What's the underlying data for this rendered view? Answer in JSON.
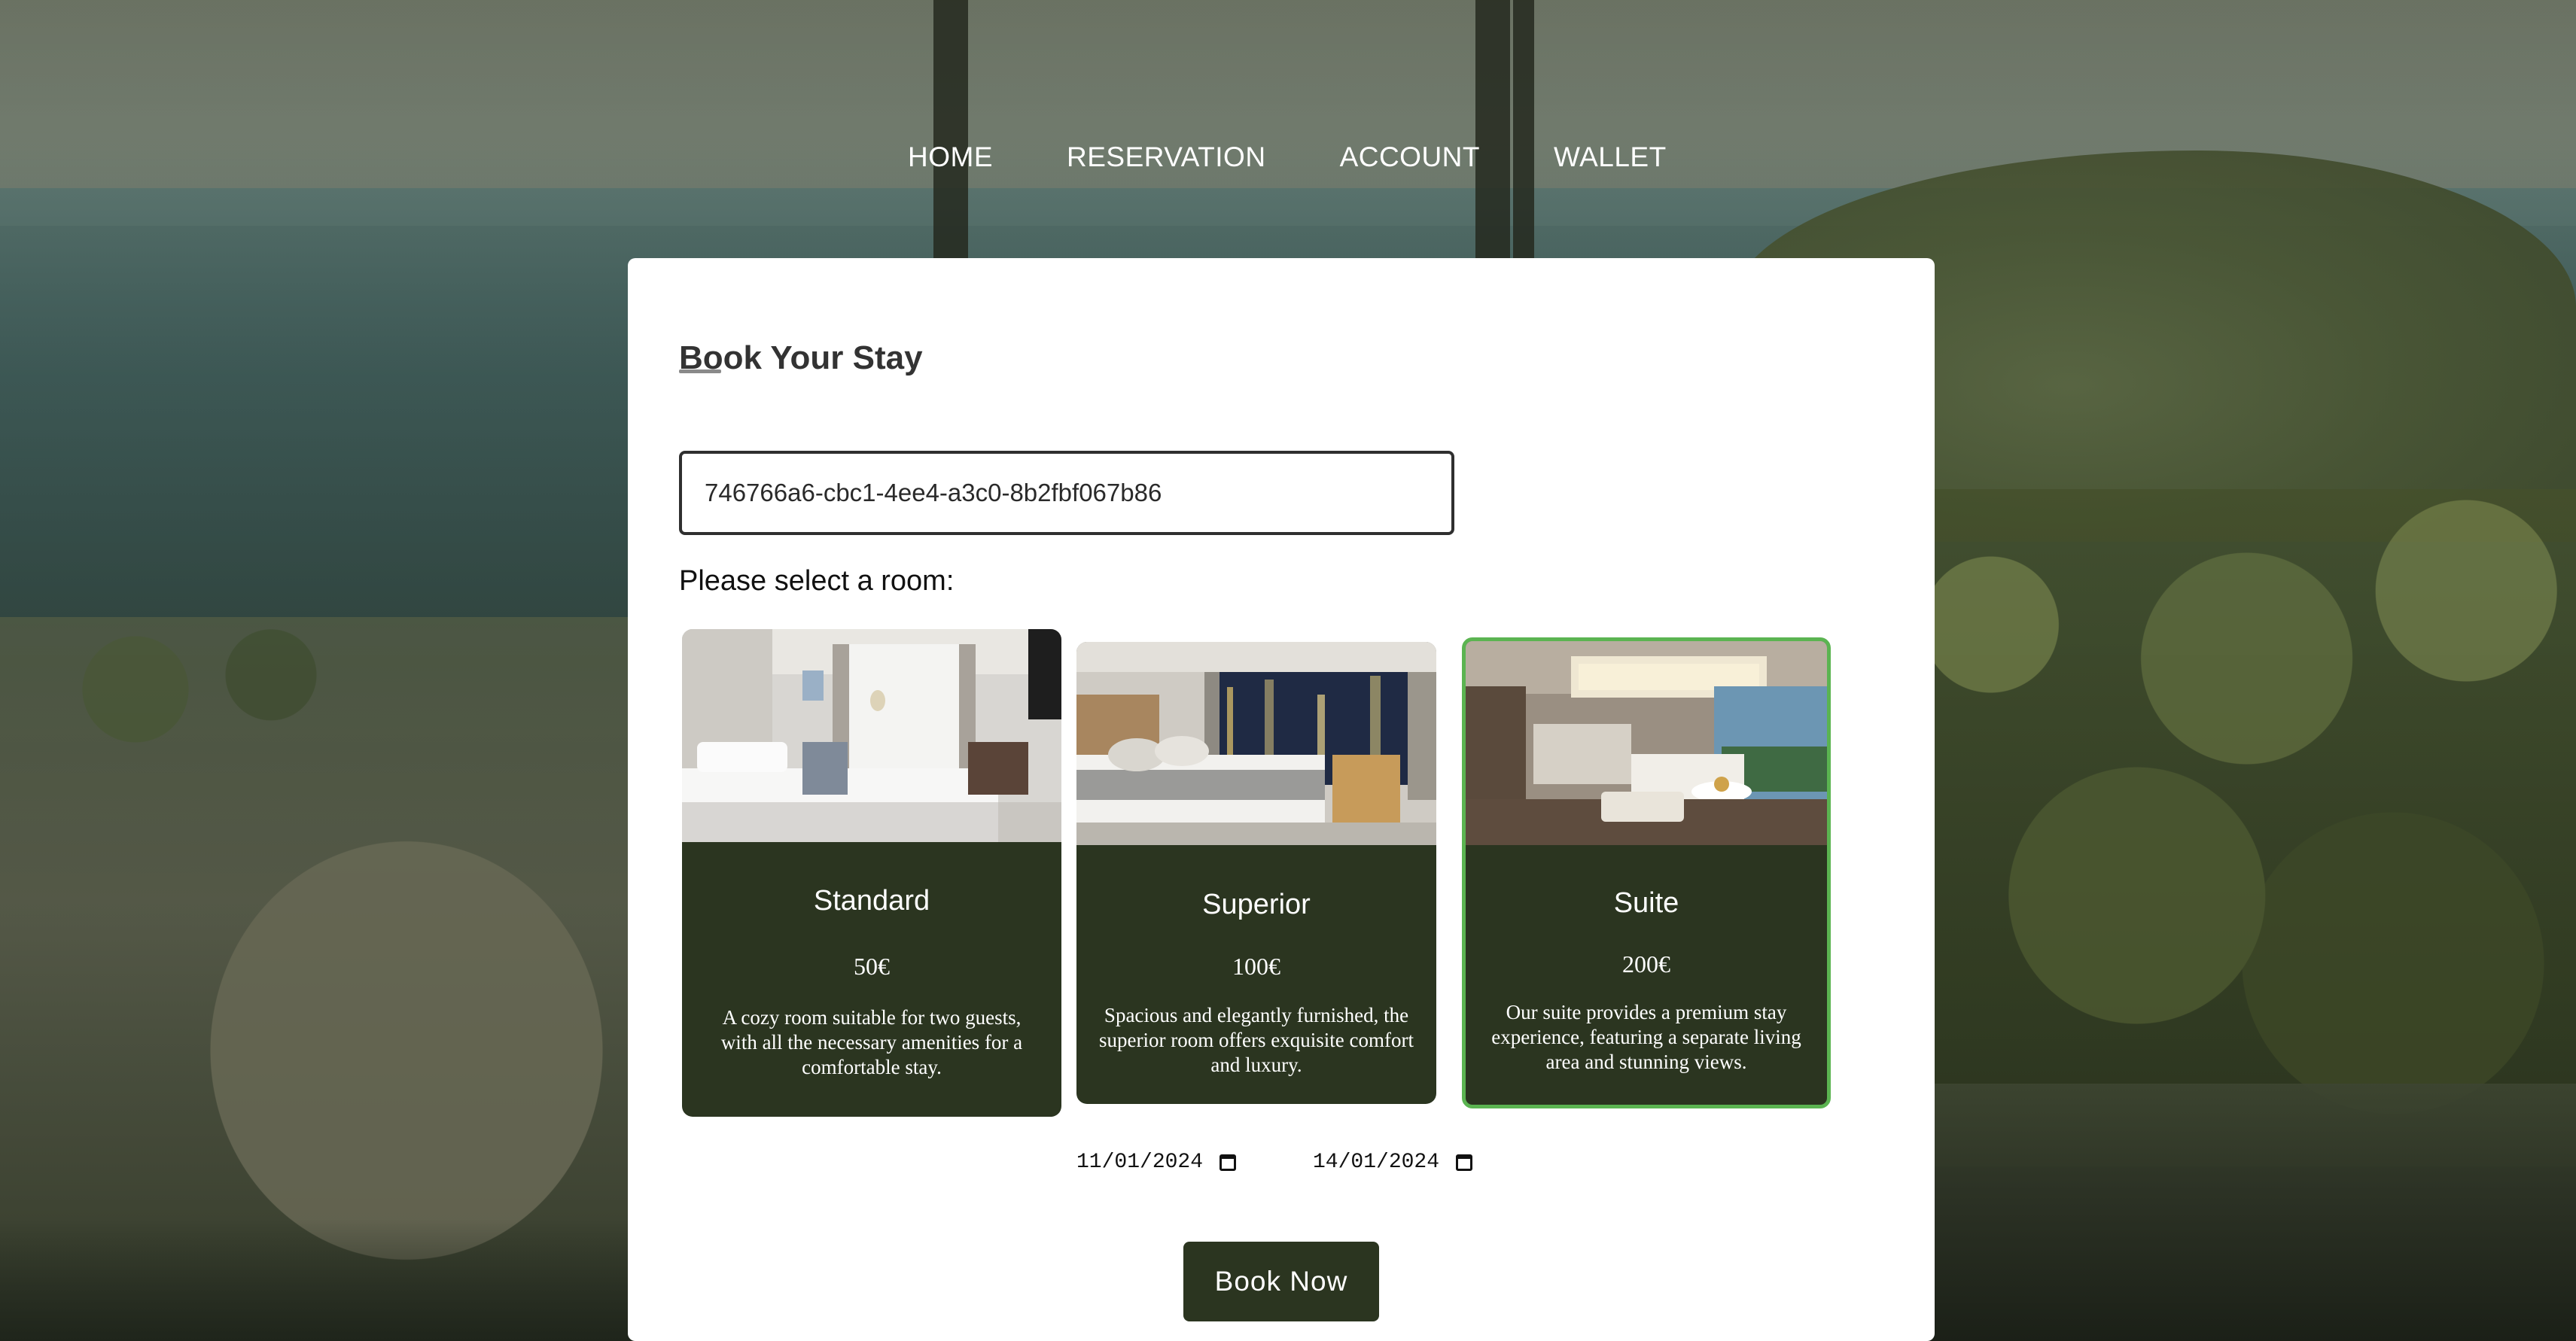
{
  "nav": {
    "items": [
      "HOME",
      "RESERVATION",
      "ACCOUNT",
      "WALLET"
    ]
  },
  "booking": {
    "title": "Book Your Stay",
    "id_value": "746766a6-cbc1-4ee4-a3c0-8b2fbf067b86",
    "room_prompt": "Please select a room:",
    "rooms": [
      {
        "name": "Standard",
        "price": "50€",
        "description": "A cozy room suitable for two guests, with all the necessary amenities for a comfortable stay.",
        "selected": false
      },
      {
        "name": "Superior",
        "price": "100€",
        "description": "Spacious and elegantly furnished, the superior room offers exquisite comfort and luxury.",
        "selected": false
      },
      {
        "name": "Suite",
        "price": "200€",
        "description": "Our suite provides a premium stay experience, featuring a separate living area and stunning views.",
        "selected": true
      }
    ],
    "check_in": "11/01/2024",
    "check_out": "14/01/2024",
    "book_button": "Book Now"
  },
  "colors": {
    "card_dark": "#2b3520",
    "selected_border": "#5bb451",
    "card_bg": "#ffffff"
  },
  "icons": {
    "date_picker": "calendar-icon"
  }
}
